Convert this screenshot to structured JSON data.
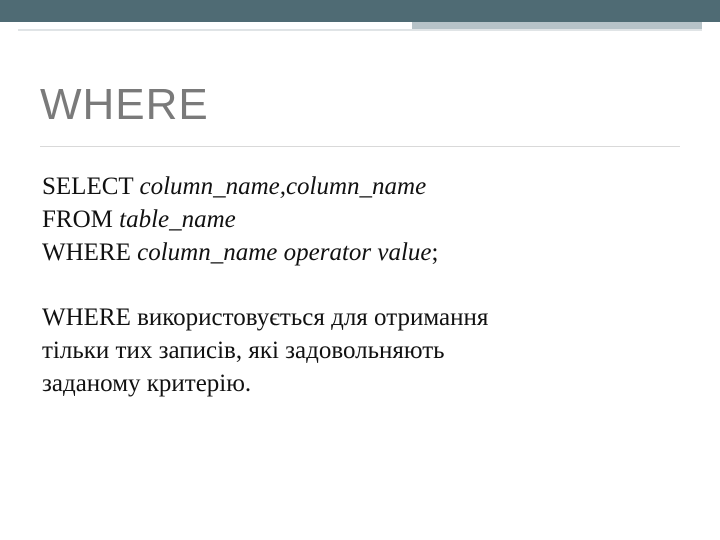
{
  "title": "WHERE",
  "sql": {
    "select_kw": "SELECT ",
    "select_args": "column_name,column_name",
    "from_kw": "FROM ",
    "from_arg": "table_name",
    "where_kw": "WHERE ",
    "where_arg": "column_name operator value",
    "terminator": ";"
  },
  "desc": {
    "line1": "WHERE використовується для отримання",
    "line2": "тільки тих записів, які задовольняють",
    "line3": "заданому критерію."
  }
}
